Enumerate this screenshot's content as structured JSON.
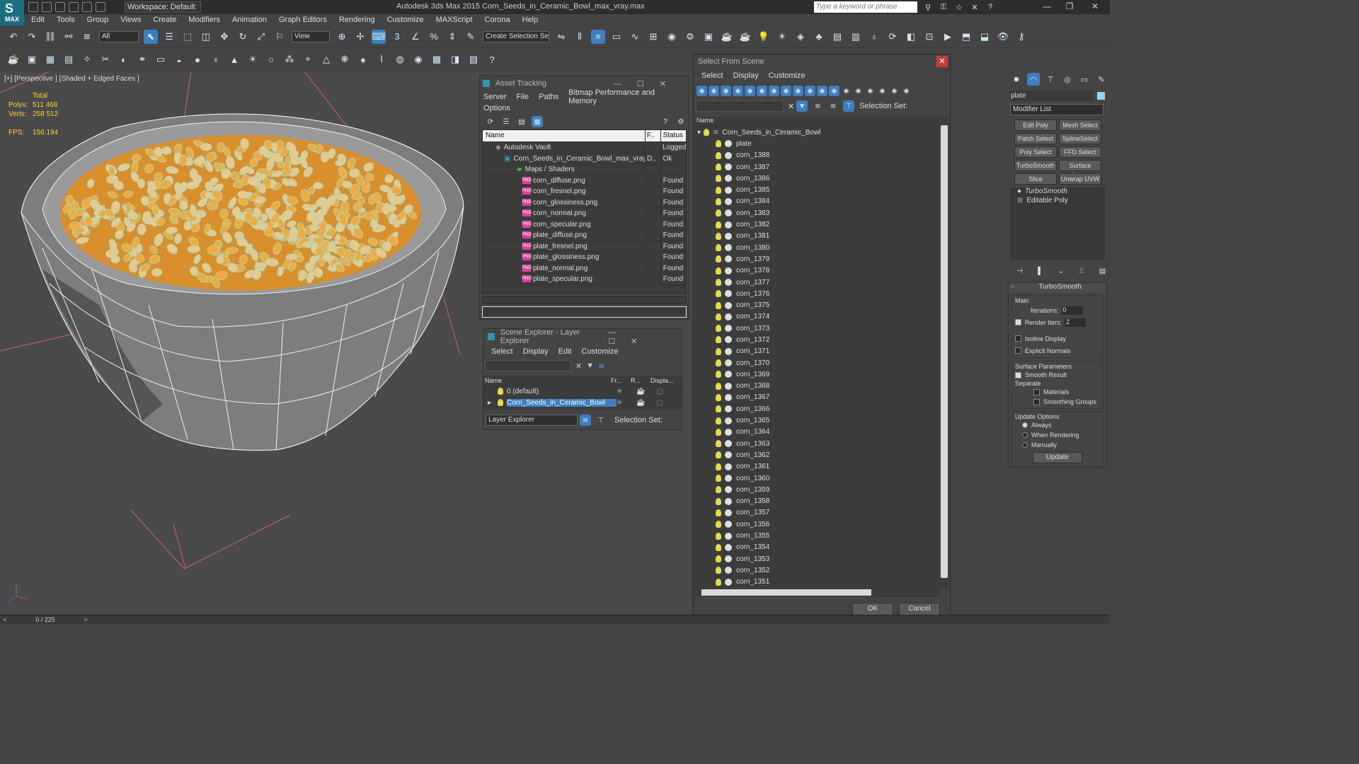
{
  "title_bar": {
    "workspace": "Workspace: Default",
    "app_title": "Autodesk 3ds Max  2015      Corn_Seeds_in_Ceramic_Bowl_max_vray.max",
    "search_placeholder": "Type a keyword or phrase",
    "logo_text": "MAX"
  },
  "menu": [
    "Edit",
    "Tools",
    "Group",
    "Views",
    "Create",
    "Modifiers",
    "Animation",
    "Graph Editors",
    "Rendering",
    "Customize",
    "MAXScript",
    "Corona",
    "Help"
  ],
  "toolbar": {
    "filter_dropdown": "All",
    "coord_dropdown": "View",
    "named_selection": "Create Selection Se"
  },
  "viewport": {
    "label": "[+] [Perspective ] [Shaded + Edged Faces ]",
    "stats": {
      "total_label": "Total",
      "polys_label": "Polys:",
      "polys_value": "511 468",
      "verts_label": "Verts:",
      "verts_value": "258 512",
      "fps_label": "FPS:",
      "fps_value": "156.194"
    }
  },
  "asset_tracking": {
    "title": "Asset Tracking",
    "menu": [
      "Server",
      "File",
      "Paths",
      "Bitmap Performance and Memory"
    ],
    "menu2": "Options",
    "columns": [
      "Name",
      "F..",
      "Status"
    ],
    "rows": [
      {
        "name": "Autodesk Vault",
        "f": "",
        "status": "Logged"
      },
      {
        "name": "Corn_Seeds_in_Ceramic_Bowl_max_vray....",
        "f": "D..",
        "status": "Ok"
      },
      {
        "name": "Maps / Shaders",
        "f": "",
        "status": ""
      },
      {
        "name": "corn_diffuse.png",
        "f": "",
        "status": "Found"
      },
      {
        "name": "corn_fresnel.png",
        "f": "",
        "status": "Found"
      },
      {
        "name": "corn_glossiness.png",
        "f": "",
        "status": "Found"
      },
      {
        "name": "corn_normal.png",
        "f": "",
        "status": "Found"
      },
      {
        "name": "corn_specular.png",
        "f": "",
        "status": "Found"
      },
      {
        "name": "plate_diffuse.png",
        "f": "",
        "status": "Found"
      },
      {
        "name": "plate_fresnel.png",
        "f": "",
        "status": "Found"
      },
      {
        "name": "plate_glossiness.png",
        "f": "",
        "status": "Found"
      },
      {
        "name": "plate_normal.png",
        "f": "",
        "status": "Found"
      },
      {
        "name": "plate_specular.png",
        "f": "",
        "status": "Found"
      }
    ],
    "png_badge": "PNG"
  },
  "scene_explorer": {
    "title": "Scene Explorer - Layer Explorer",
    "menu": [
      "Select",
      "Display",
      "Edit",
      "Customize"
    ],
    "columns": [
      "Name",
      "Fr...",
      "R...",
      "Displa..."
    ],
    "layers": [
      "0 (default)",
      "Corn_Seeds_in_Ceramic_Bowl"
    ],
    "footer_dropdown": "Layer Explorer",
    "selection_set_label": "Selection Set:"
  },
  "select_from_scene": {
    "title": "Select From Scene",
    "menu": [
      "Select",
      "Display",
      "Customize"
    ],
    "selection_set_label": "Selection Set:",
    "column_name": "Name",
    "root": "Corn_Seeds_in_Ceramic_Bowl",
    "items": [
      "plate",
      "corn_1388",
      "corn_1387",
      "corn_1386",
      "corn_1385",
      "corn_1384",
      "corn_1383",
      "corn_1382",
      "corn_1381",
      "corn_1380",
      "corn_1379",
      "corn_1378",
      "corn_1377",
      "corn_1376",
      "corn_1375",
      "corn_1374",
      "corn_1373",
      "corn_1372",
      "corn_1371",
      "corn_1370",
      "corn_1369",
      "corn_1368",
      "corn_1367",
      "corn_1366",
      "corn_1365",
      "corn_1364",
      "corn_1363",
      "corn_1362",
      "corn_1361",
      "corn_1360",
      "corn_1359",
      "corn_1358",
      "corn_1357",
      "corn_1356",
      "corn_1355",
      "corn_1354",
      "corn_1353",
      "corn_1352",
      "corn_1351"
    ],
    "ok": "OK",
    "cancel": "Cancel"
  },
  "command_panel": {
    "object_name": "plate",
    "modifier_list": "Modifier List",
    "modifier_buttons": [
      "Edit Poly",
      "Mesh Select",
      "Patch Select",
      "SplineSelect",
      "Poly Select",
      "FFD Select",
      "TurboSmooth",
      "Surface Select",
      "Slice",
      "Unwrap UVW"
    ],
    "stack": [
      "TurboSmooth",
      "Editable Poly"
    ],
    "rollout_title": "TurboSmooth",
    "main_label": "Main",
    "iterations_label": "Iterations:",
    "iterations_value": "0",
    "render_iters_label": "Render Iters:",
    "render_iters_value": "2",
    "isoline": "Isoline Display",
    "explicit_normals": "Explicit Normals",
    "surface_params": "Surface Parameters",
    "smooth_result": "Smooth Result",
    "separate": "Separate",
    "materials": "Materials",
    "smoothing_groups": "Smoothing Groups",
    "update_options": "Update Options",
    "always": "Always",
    "when_rendering": "When Rendering",
    "manually": "Manually",
    "update_button": "Update"
  },
  "status_bar": {
    "frame": "0 / 225"
  },
  "colors": {
    "accent_blue": "#3f7fbf",
    "bulb_yellow": "#e8d84c",
    "stat_yellow": "#ffcc33"
  }
}
